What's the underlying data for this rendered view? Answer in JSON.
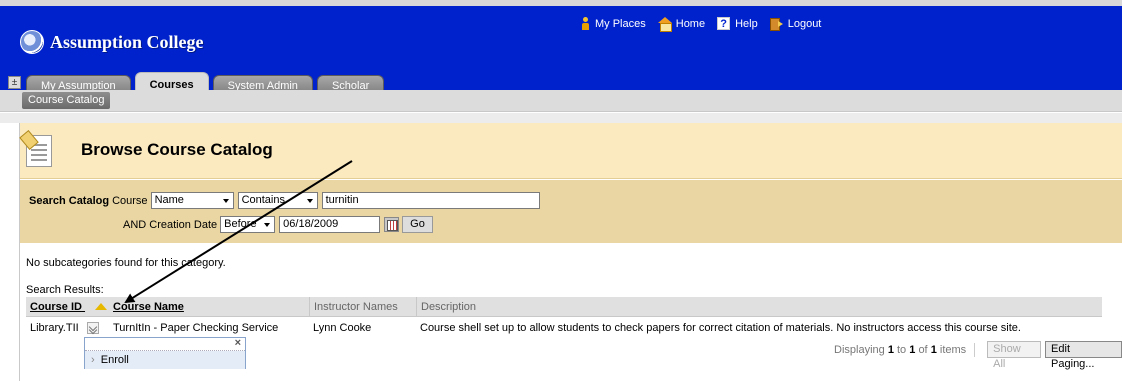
{
  "header": {
    "logo_text": "Assumption College",
    "top_links": [
      {
        "label": "My Places",
        "icon": "person-icon"
      },
      {
        "label": "Home",
        "icon": "home-icon"
      },
      {
        "label": "Help",
        "icon": "help-icon"
      },
      {
        "label": "Logout",
        "icon": "logout-icon"
      }
    ],
    "help_glyph": "?",
    "expand_glyph": "±",
    "tabs": [
      {
        "label": "My Assumption",
        "active": false
      },
      {
        "label": "Courses",
        "active": true
      },
      {
        "label": "System Admin",
        "active": false
      },
      {
        "label": "Scholar",
        "active": false
      }
    ],
    "colors": {
      "header_bg": "#0022cc",
      "title_bg": "#fbeabf",
      "search_bg": "#e9d6a2"
    }
  },
  "subnav": {
    "button_label": "Course Catalog"
  },
  "main": {
    "page_title": "Browse Course Catalog",
    "search": {
      "label": "Search Catalog",
      "course_label": "Course",
      "field_select": "Name",
      "operator_select": "Contains",
      "search_value": "turnitin",
      "and_label": "AND Creation Date",
      "date_operator": "Before",
      "date_value": "06/18/2009",
      "go_label": "Go"
    },
    "no_subcategories": "No subcategories found for this category.",
    "results_label": "Search Results:",
    "table": {
      "headers": [
        "Course ID",
        "Course Name",
        "Instructor Names",
        "Description"
      ],
      "rows": [
        {
          "course_id": "Library.TII",
          "course_name": "TurnItIn - Paper Checking Service",
          "instructor": "Lynn Cooke",
          "description": "Course shell set up to allow students to check papers for correct citation of materials. No instructors access this course site."
        }
      ]
    },
    "context_menu": {
      "close_glyph": "×",
      "item_chevron": "›",
      "item_label": "Enroll"
    },
    "paging": {
      "prefix": "Displaying",
      "from": "1",
      "to_word": "to",
      "to": "1",
      "of_word": "of",
      "total": "1",
      "suffix": "items",
      "show_all_label": "Show All",
      "edit_paging_label": "Edit Paging..."
    }
  }
}
